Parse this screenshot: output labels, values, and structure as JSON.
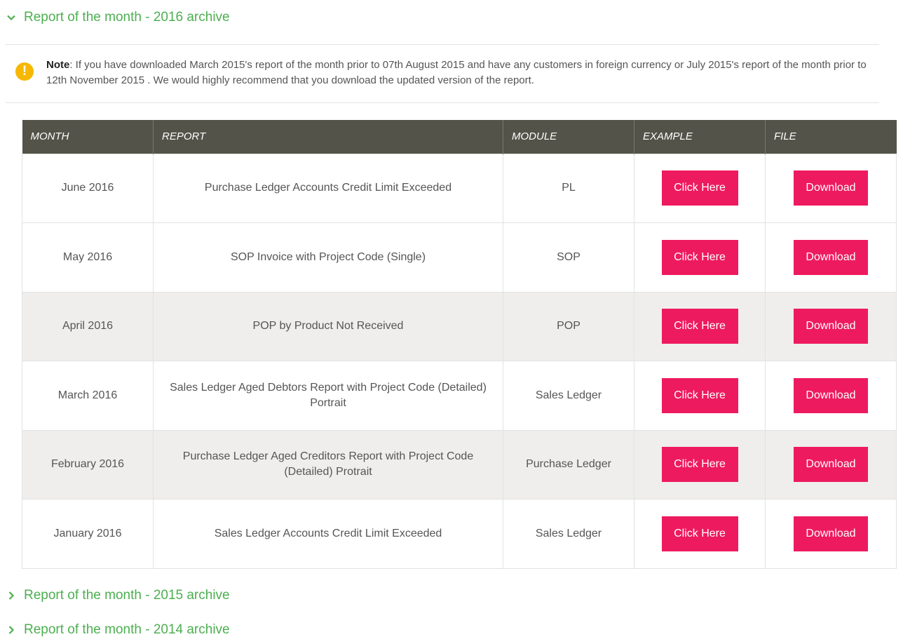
{
  "accordions": {
    "a2016": "Report of the month - 2016 archive",
    "a2015": "Report of the month - 2015 archive",
    "a2014": "Report of the month - 2014 archive"
  },
  "note": {
    "label": "Note",
    "text": ": If you have downloaded March 2015's report of the month prior to 07th August 2015 and have any customers in foreign currency or July 2015's report of the month prior to 12th November 2015 . We would highly recommend that you download the updated version of the report."
  },
  "table": {
    "headers": [
      "MONTH",
      "REPORT",
      "MODULE",
      "EXAMPLE",
      "FILE"
    ],
    "rows": [
      {
        "month": "June 2016",
        "report": "Purchase Ledger Accounts Credit Limit Exceeded",
        "module": "PL",
        "example": "Click Here",
        "file": "Download"
      },
      {
        "month": "May 2016",
        "report": "SOP Invoice with Project Code (Single)",
        "module": "SOP",
        "example": "Click Here",
        "file": "Download"
      },
      {
        "month": "April 2016",
        "report": "POP by Product Not Received",
        "module": "POP",
        "example": "Click Here",
        "file": "Download"
      },
      {
        "month": "March 2016",
        "report": "Sales Ledger Aged Debtors Report with Project Code (Detailed) Portrait",
        "module": "Sales Ledger",
        "example": "Click Here",
        "file": "Download"
      },
      {
        "month": "February 2016",
        "report": "Purchase Ledger Aged Creditors Report with Project Code (Detailed) Protrait",
        "module": "Purchase Ledger",
        "example": "Click Here",
        "file": "Download"
      },
      {
        "month": "January 2016",
        "report": "Sales Ledger Accounts Credit Limit Exceeded",
        "module": "Sales Ledger",
        "example": "Click Here",
        "file": "Download"
      }
    ]
  },
  "colors": {
    "accent_green": "#4caf50",
    "button_pink": "#ee1a5f",
    "header_bg": "#545349",
    "note_icon": "#f6b800"
  }
}
